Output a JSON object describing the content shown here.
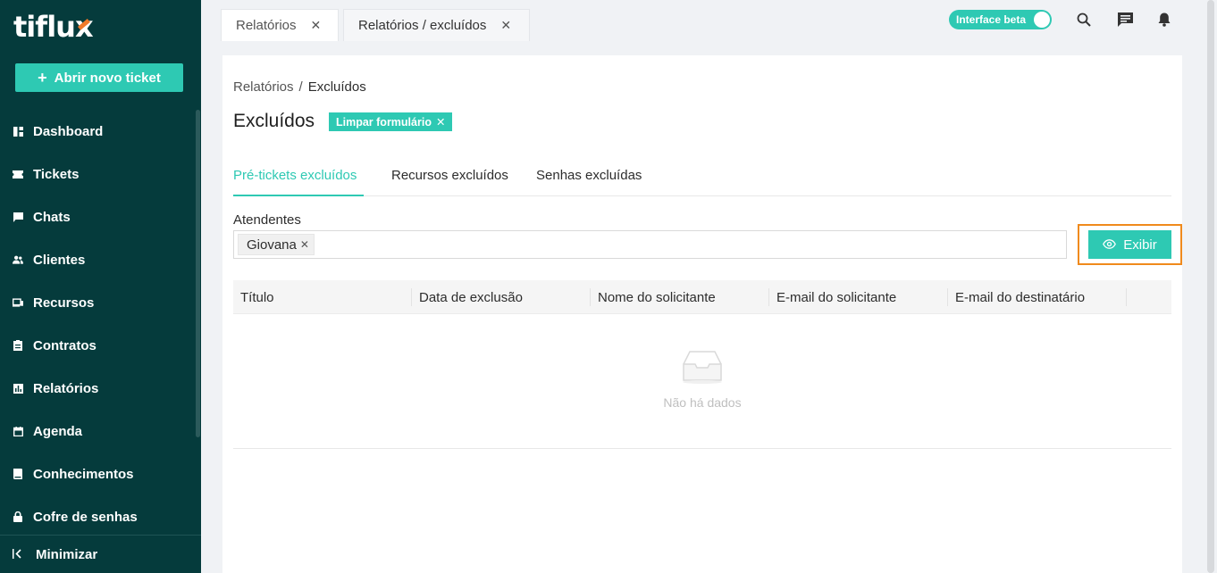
{
  "sidebar": {
    "logo": {
      "text_start": "tiflu",
      "text_x": "x"
    },
    "new_ticket": "Abrir novo ticket",
    "items": [
      {
        "label": "Dashboard",
        "icon": "dashboard-icon"
      },
      {
        "label": "Tickets",
        "icon": "ticket-icon"
      },
      {
        "label": "Chats",
        "icon": "chat-icon"
      },
      {
        "label": "Clientes",
        "icon": "clients-icon"
      },
      {
        "label": "Recursos",
        "icon": "resources-icon"
      },
      {
        "label": "Contratos",
        "icon": "contracts-icon"
      },
      {
        "label": "Relatórios",
        "icon": "reports-icon"
      },
      {
        "label": "Agenda",
        "icon": "calendar-icon"
      },
      {
        "label": "Conhecimentos",
        "icon": "knowledge-icon"
      },
      {
        "label": "Cofre de senhas",
        "icon": "lock-icon"
      }
    ],
    "minimize": "Minimizar"
  },
  "topbar": {
    "tabs": [
      {
        "label": "Relatórios"
      },
      {
        "label": "Relatórios / excluídos"
      }
    ],
    "beta_toggle": "Interface beta",
    "icons": [
      "search-icon",
      "message-icon",
      "bell-icon"
    ]
  },
  "page": {
    "breadcrumb": {
      "parent": "Relatórios",
      "separator": "/",
      "current": "Excluídos"
    },
    "title": "Excluídos",
    "clear_form": "Limpar formulário",
    "tabs": [
      "Pré-tickets excluídos",
      "Recursos excluídos",
      "Senhas excluídas"
    ],
    "filter_label": "Atendentes",
    "selected_tag": "Giovana",
    "show_button": "Exibir",
    "table": {
      "columns": [
        "Título",
        "Data de exclusão",
        "Nome do solicitante",
        "E-mail do solicitante",
        "E-mail do destinatário"
      ],
      "empty_text": "Não há dados"
    }
  },
  "colors": {
    "sidebar_bg": "#053b3c",
    "accent": "#2ec9b3",
    "highlight": "#f08a1c"
  }
}
